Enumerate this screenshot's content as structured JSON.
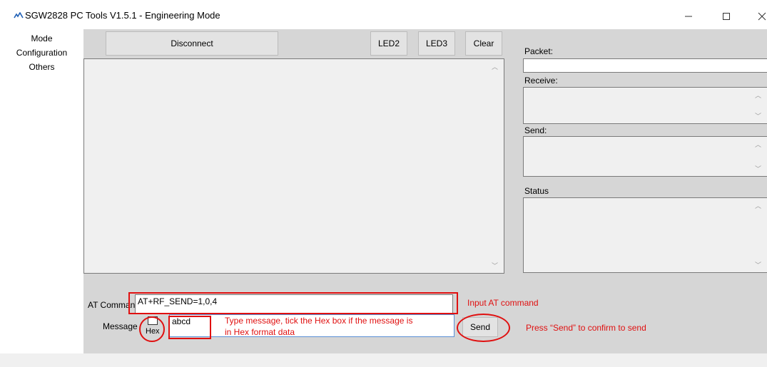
{
  "window": {
    "app_icon": "sgw-app-icon",
    "title": "SGW2828 PC Tools V1.5.1 - Engineering Mode",
    "controls": {
      "minimize": "—",
      "maximize": "☐",
      "close": "✕"
    }
  },
  "nav": {
    "items": [
      {
        "label": "Mode"
      },
      {
        "label": "Configuration"
      },
      {
        "label": "Others"
      }
    ]
  },
  "toolbar": {
    "disconnect_label": "Disconnect",
    "led2_label": "LED2",
    "led3_label": "LED3",
    "clear_label": "Clear"
  },
  "right_panel": {
    "packet_label": "Packet:",
    "receive_label": "Receive:",
    "send_label": "Send:",
    "status_label": "Status"
  },
  "form": {
    "at_command_label": "AT Command",
    "at_command_value": "AT+RF_SEND=1,0,4",
    "message_label": "Message",
    "hex_label": "Hex",
    "hex_checked": false,
    "message_value": "abcd",
    "send_label": "Send"
  },
  "annotations": {
    "at_command_note": "Input AT command",
    "message_note_line1": "Type message, tick the Hex box if the message is",
    "message_note_line2": "in Hex format data",
    "send_note": "Press “Send” to confirm to send",
    "color": "#e01010"
  },
  "colors": {
    "panel_bg": "#d6d6d6",
    "button_bg": "#e3e3e3",
    "annotation": "#e01010"
  }
}
